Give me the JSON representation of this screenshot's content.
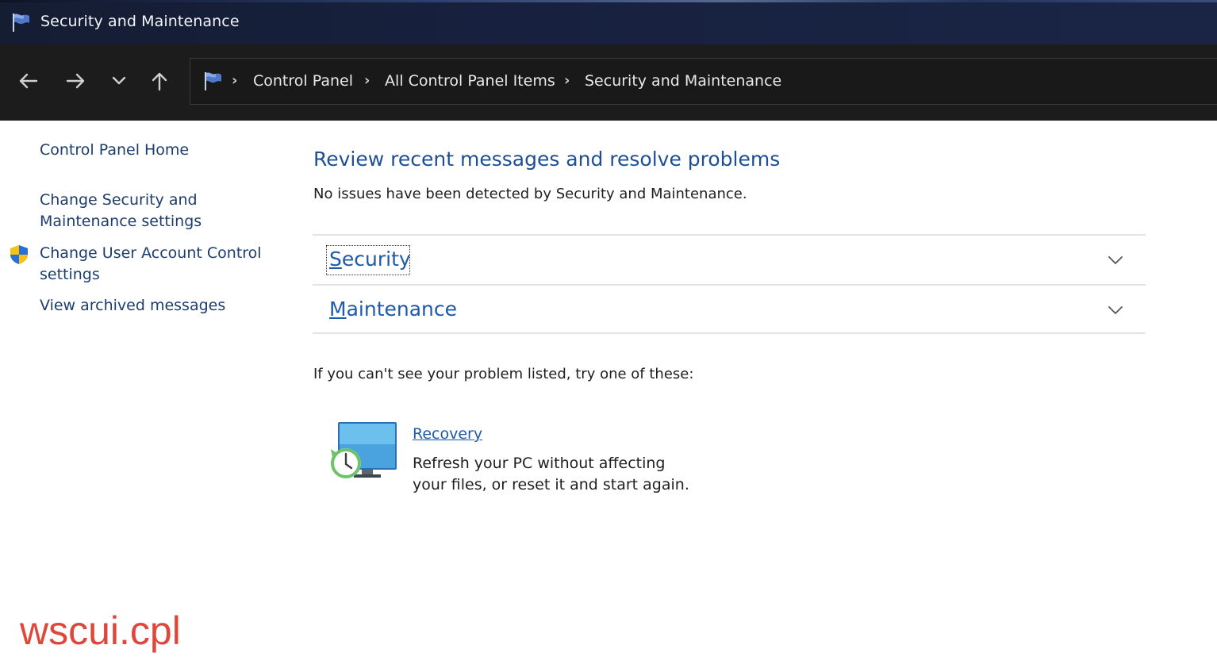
{
  "window": {
    "title": "Security and Maintenance",
    "icon": "flag-icon"
  },
  "nav": {
    "back_icon": "back-arrow-icon",
    "forward_icon": "forward-arrow-icon",
    "recent_icon": "chevron-down-icon",
    "up_icon": "up-arrow-icon",
    "breadcrumb": [
      {
        "label": "Control Panel"
      },
      {
        "label": "All Control Panel Items"
      },
      {
        "label": "Security and Maintenance"
      }
    ],
    "separator": "›"
  },
  "sidebar": {
    "home": "Control Panel Home",
    "change_security_line1": "Change Security and",
    "change_security_line2": "Maintenance settings",
    "change_uac_line1": "Change User Account Control",
    "change_uac_line2": "settings",
    "view_archived": "View archived messages"
  },
  "main": {
    "title": "Review recent messages and resolve problems",
    "subtitle": "No issues have been detected by Security and Maintenance.",
    "sections": [
      {
        "first": "S",
        "rest": "ecurity"
      },
      {
        "first": "M",
        "rest": "aintenance"
      }
    ],
    "try_text": "If you can't see your problem listed, try one of these:",
    "recovery": {
      "first": "R",
      "rest": "ecovery",
      "desc_line1": "Refresh your PC without affecting",
      "desc_line2": "your files, or reset it and start again."
    }
  },
  "overlay": {
    "caption": "wscui.cpl",
    "color": "#e0473b"
  },
  "colors": {
    "link": "#1e5aa8",
    "heading": "#1e4f94",
    "titlebar": "#17213f",
    "navbar": "#1c1c1c"
  }
}
